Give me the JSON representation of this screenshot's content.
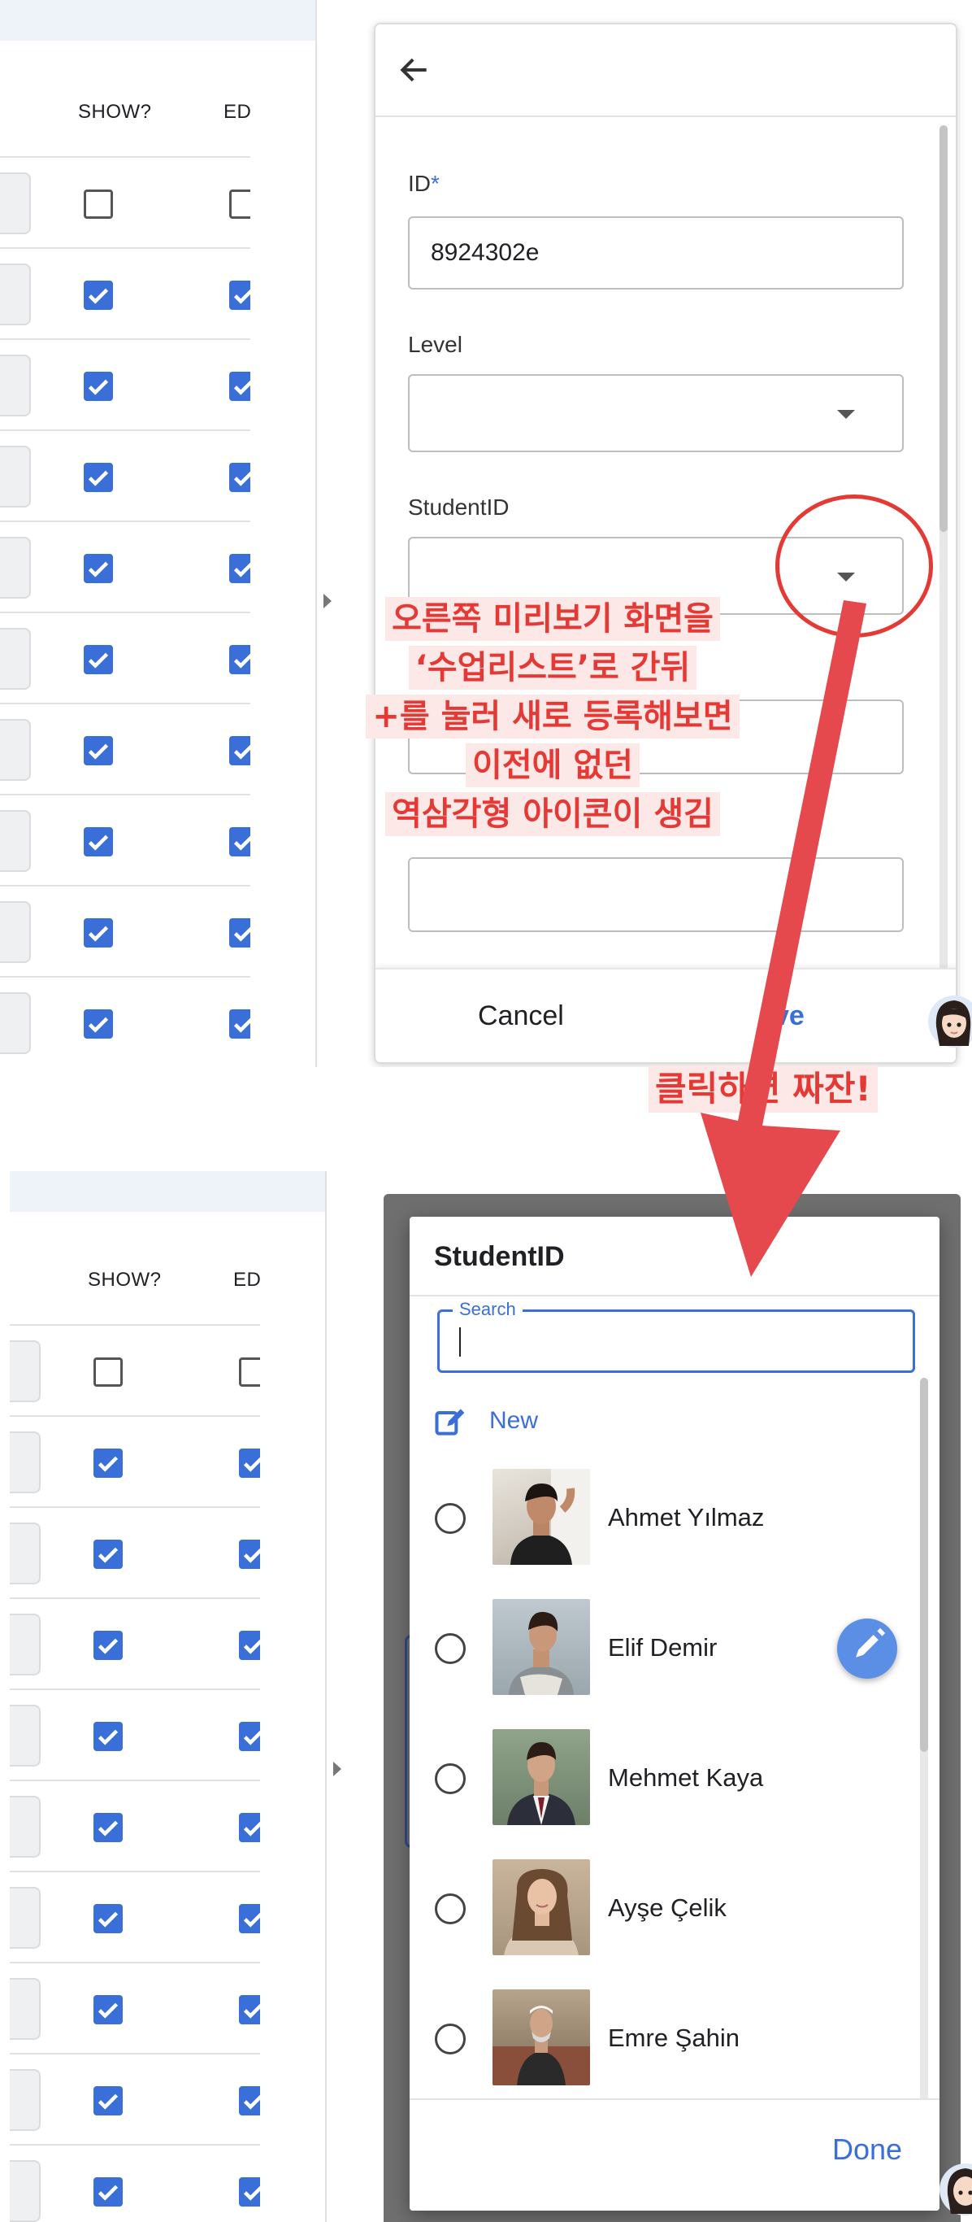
{
  "table": {
    "col_show": "SHOW?",
    "col_edit": "ED",
    "rows_checked": [
      false,
      true,
      true,
      true,
      true,
      true,
      true,
      true,
      true,
      true
    ]
  },
  "form": {
    "id_label": "ID",
    "id_required_mark": "*",
    "id_value": "8924302e",
    "level_label": "Level",
    "level_value": "",
    "student_label": "StudentID",
    "student_value": "",
    "cancel_label": "Cancel",
    "save_label": "ve"
  },
  "annotations": {
    "main_lines": [
      "오른쪽 미리보기 화면을",
      "‘수업리스트’로 간뒤",
      "+를 눌러 새로 등록해보면",
      "이전에 없던",
      "역삼각형 아이콘이 생김"
    ],
    "click_note": "클릭하면 짜잔!",
    "accent_color": "#e53935"
  },
  "picker": {
    "title": "StudentID",
    "search_label": "Search",
    "search_value": "",
    "new_label": "New",
    "students": [
      {
        "name": "Ahmet Yılmaz"
      },
      {
        "name": "Elif Demir"
      },
      {
        "name": "Mehmet Kaya"
      },
      {
        "name": "Ayşe Çelik"
      },
      {
        "name": "Emre Şahin"
      }
    ],
    "done_label": "Done"
  },
  "colors": {
    "accent": "#3b6fd8",
    "checkbox": "#3b6fd8",
    "annotation": "#e53935"
  }
}
